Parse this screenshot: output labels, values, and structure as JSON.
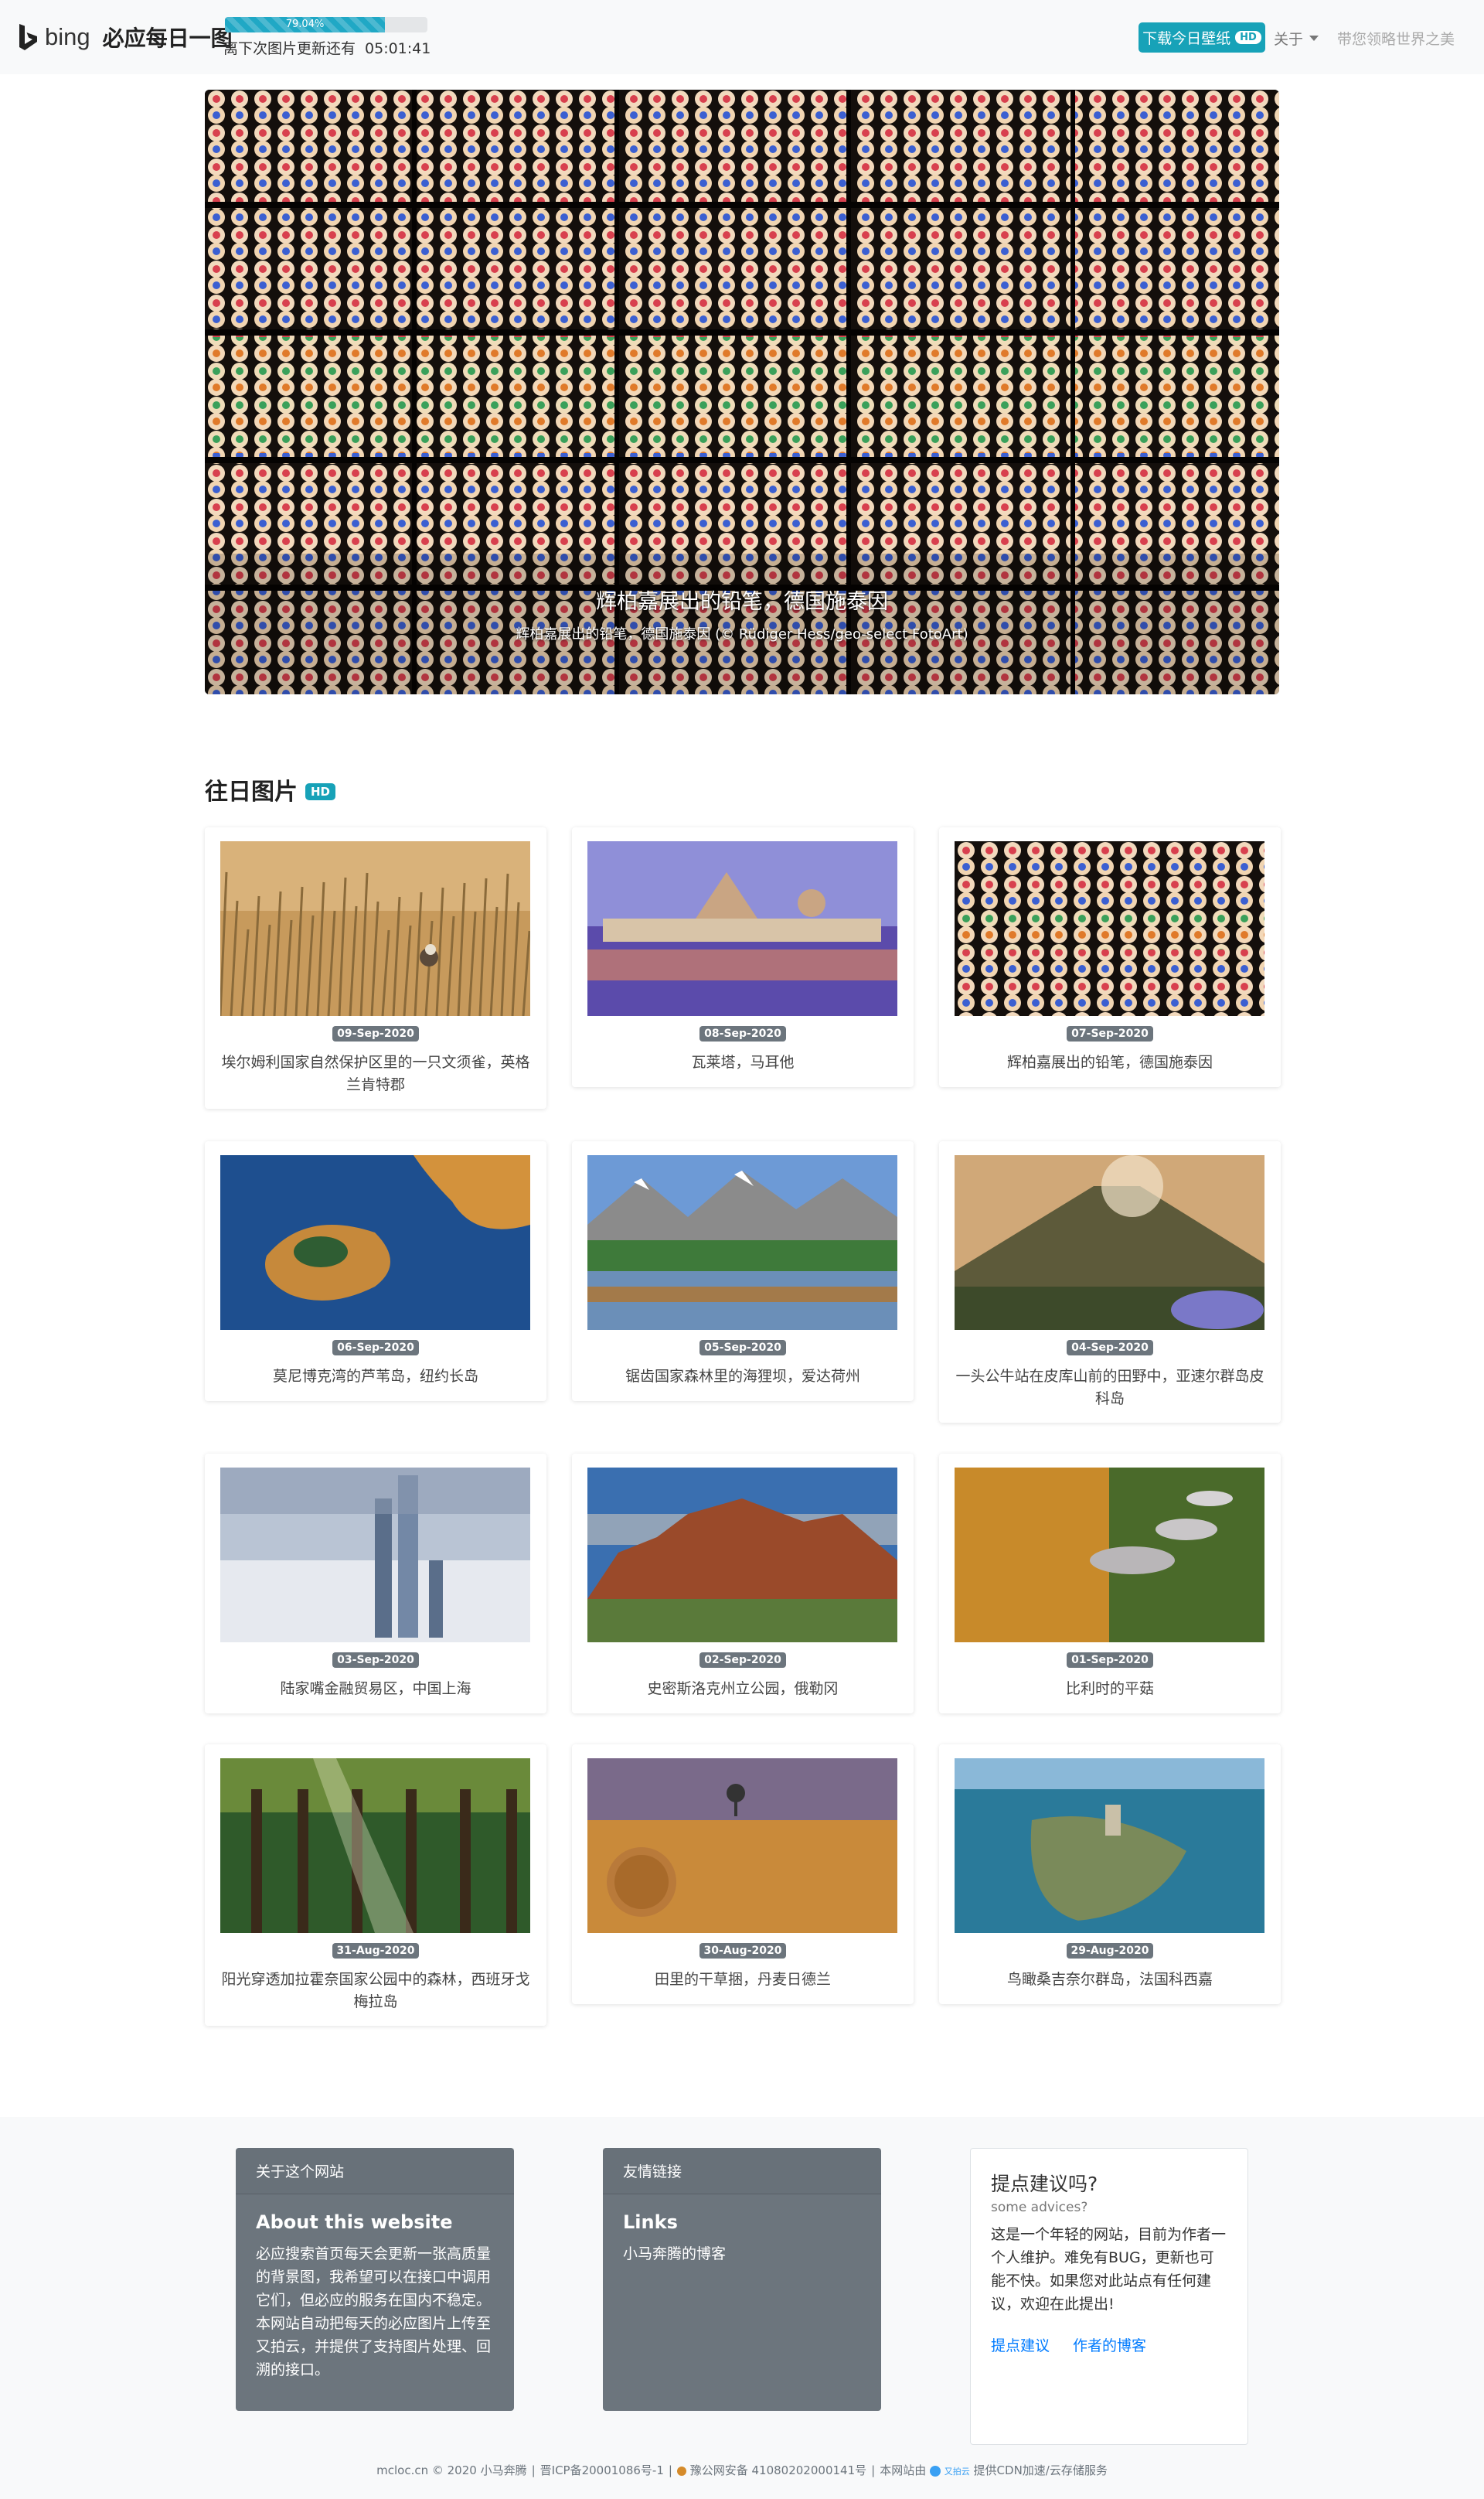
{
  "navbar": {
    "brand_text": "bing",
    "site_title": "必应每日一图",
    "progress_label": "79.04%",
    "progress_value": 0.7904,
    "countdown_label": "离下次图片更新还有",
    "countdown_time": "05:01:41",
    "download_label": "下载今日壁纸",
    "download_badge": "HD",
    "about_label": "关于",
    "slogan": "带您领略世界之美",
    "accent_color": "#17a2b8"
  },
  "hero": {
    "title": "辉柏嘉展出的铅笔，德国施泰因",
    "subtitle": "辉柏嘉展出的铅笔，德国施泰因 (© Rüdiger Hess/geo-select FotoArt)",
    "indicators": [
      true,
      false,
      false
    ]
  },
  "gallery": {
    "title": "往日图片",
    "badge": "HD",
    "items": [
      {
        "date": "09-Sep-2020",
        "title": "埃尔姆利国家自然保护区里的一只文须雀，英格兰肯特郡",
        "icon": "reed-bird-photo"
      },
      {
        "date": "08-Sep-2020",
        "title": "瓦莱塔，马耳他",
        "icon": "city-harbor-photo"
      },
      {
        "date": "07-Sep-2020",
        "title": "辉柏嘉展出的铅笔，德国施泰因",
        "icon": "pencils-photo"
      },
      {
        "date": "06-Sep-2020",
        "title": "莫尼博克湾的芦苇岛，纽约长岛",
        "icon": "island-photo"
      },
      {
        "date": "05-Sep-2020",
        "title": "锯齿国家森林里的海狸坝，爱达荷州",
        "icon": "mountain-lake-photo"
      },
      {
        "date": "04-Sep-2020",
        "title": "一头公牛站在皮库山前的田野中，亚速尔群岛皮科岛",
        "icon": "volcano-photo"
      },
      {
        "date": "03-Sep-2020",
        "title": "陆家嘴金融贸易区，中国上海",
        "icon": "skyscraper-photo"
      },
      {
        "date": "02-Sep-2020",
        "title": "史密斯洛克州立公园，俄勒冈",
        "icon": "rock-canyon-photo"
      },
      {
        "date": "01-Sep-2020",
        "title": "比利时的平菇",
        "icon": "mushroom-photo"
      },
      {
        "date": "31-Aug-2020",
        "title": "阳光穿透加拉霍奈国家公园中的森林，西班牙戈梅拉岛",
        "icon": "forest-photo"
      },
      {
        "date": "30-Aug-2020",
        "title": "田里的干草捆，丹麦日德兰",
        "icon": "hay-bale-photo"
      },
      {
        "date": "29-Aug-2020",
        "title": "鸟瞰桑吉奈尔群岛，法国科西嘉",
        "icon": "coast-tower-photo"
      }
    ]
  },
  "footer": {
    "about": {
      "header": "关于这个网站",
      "title": "About this website",
      "body": "必应搜索首页每天会更新一张高质量的背景图，我希望可以在接口中调用它们，但必应的服务在国内不稳定。本网站自动把每天的必应图片上传至又拍云，并提供了支持图片处理、回溯的接口。"
    },
    "links": {
      "header": "友情链接",
      "title": "Links",
      "link": "小马奔腾的博客"
    },
    "advice": {
      "title": "提点建议吗?",
      "subtitle": "some advices?",
      "body": "这是一个年轻的网站，目前为作者一个人维护。难免有BUG，更新也可能不快。如果您对此站点有任何建议，欢迎在此提出!",
      "link1": "提点建议",
      "link2": "作者的博客"
    },
    "copyright": {
      "site": "mcloc.cn © 2020 小马奔腾",
      "icp": "晋ICP备20001086号-1",
      "police": "豫公网安备 41080202000141号",
      "cdn_prefix": "本网站由",
      "cdn_logo": "又拍云",
      "cdn_suffix": "提供CDN加速/云存储服务"
    }
  }
}
